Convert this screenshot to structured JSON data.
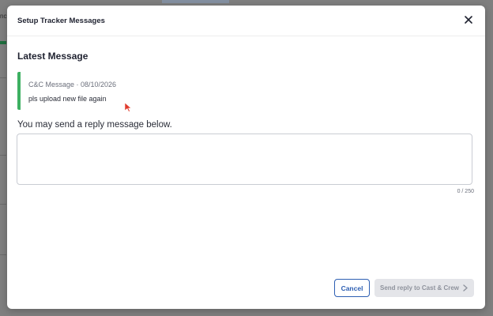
{
  "modal": {
    "title": "Setup Tracker Messages",
    "close_icon": "close-icon"
  },
  "latest_message": {
    "heading": "Latest Message",
    "meta": "C&C Message · 08/10/2026",
    "body": "pls upload new file again",
    "accent_color": "#3db062"
  },
  "reply": {
    "prompt": "You may send a reply message below.",
    "value": "",
    "char_count": "0 / 250"
  },
  "actions": {
    "cancel_label": "Cancel",
    "send_label": "Send reply to Cast & Crew",
    "send_icon": "chevron-right-icon",
    "primary_color": "#2d5fb3"
  },
  "background": {
    "partial_text": "nc"
  }
}
